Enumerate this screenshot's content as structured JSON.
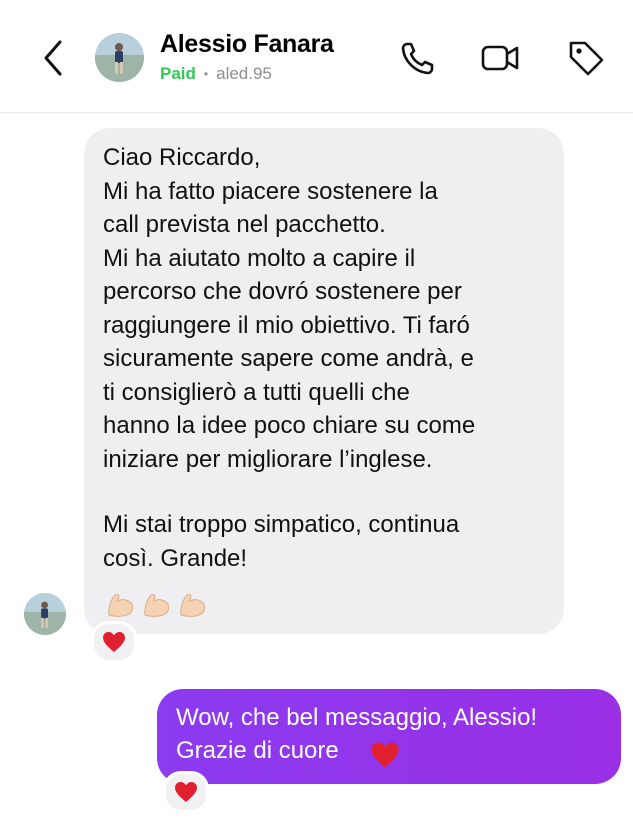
{
  "header": {
    "contact_name": "Alessio Fanara",
    "status": "Paid",
    "username": "aled.95",
    "separator": "•"
  },
  "messages": {
    "incoming": {
      "paragraph1": "Ciao Riccardo,\nMi ha fatto piacere sostenere la\ncall prevista nel pacchetto.\nMi ha aiutato molto a capire il\npercorso che dovró sostenere per\nraggiungere il mio obiettivo. Ti faró\nsicuramente sapere come andrà, e\nti consiglierò a tutti quelli che\nhanno la idee poco chiare su come\niniziare per migliorare l’inglese.",
      "paragraph2": "Mi stai troppo simpatico, continua\ncosì. Grande!",
      "emojis": [
        "flexed-biceps",
        "flexed-biceps",
        "flexed-biceps"
      ],
      "reaction": "red-heart"
    },
    "outgoing": {
      "text": "Wow, che bel messaggio, Alessio!\nGrazie di cuore",
      "emoji": "red-heart",
      "reaction": "red-heart"
    }
  },
  "colors": {
    "incoming_bubble": "#efeff1",
    "outgoing_bubble": "#9334ea",
    "paid": "#35c759",
    "muted": "#8e8e93",
    "heart": "#e0202e"
  }
}
